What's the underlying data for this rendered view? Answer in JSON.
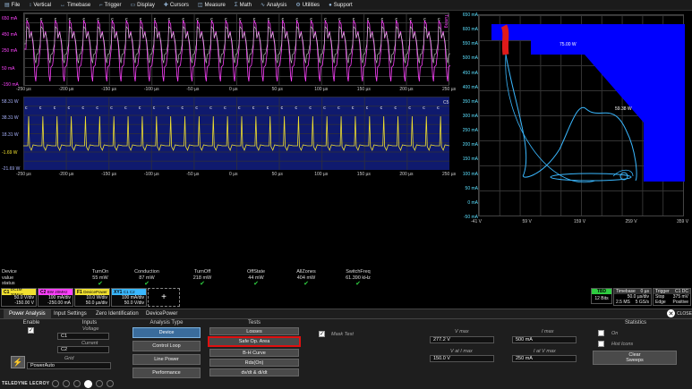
{
  "menu": [
    {
      "label": "File",
      "icon": "file-icon"
    },
    {
      "label": "Vertical",
      "icon": "vertical-icon"
    },
    {
      "label": "Timebase",
      "icon": "timebase-icon"
    },
    {
      "label": "Trigger",
      "icon": "trigger-icon"
    },
    {
      "label": "Display",
      "icon": "display-icon"
    },
    {
      "label": "Cursors",
      "icon": "cursors-icon"
    },
    {
      "label": "Measure",
      "icon": "measure-icon"
    },
    {
      "label": "Math",
      "icon": "math-icon"
    },
    {
      "label": "Analysis",
      "icon": "analysis-icon"
    },
    {
      "label": "Utilities",
      "icon": "utilities-icon"
    },
    {
      "label": "Support",
      "icon": "support-icon"
    }
  ],
  "top_grid": {
    "y_labels": [
      "650 mA",
      "450 mA",
      "250 mA",
      "50 mA",
      "-150 mA"
    ],
    "x_labels": [
      "-250 µs",
      "-200 µs",
      "-150 µs",
      "-100 µs",
      "-50 µs",
      "0 µs",
      "50 µs",
      "100 µs",
      "150 µs",
      "200 µs",
      "250 µs"
    ],
    "tag": "Tuning"
  },
  "mid_grid": {
    "y_labels": [
      "58.31 W",
      "38.31 W",
      "18.31 W",
      "-1.69 W",
      "-21.69 W"
    ],
    "x_labels": [
      "-250 µs",
      "-200 µs",
      "-150 µs",
      "-100 µs",
      "-50 µs",
      "0 µs",
      "50 µs",
      "100 µs",
      "150 µs",
      "200 µs",
      "250 µs"
    ],
    "tag": "C5"
  },
  "soa_plot": {
    "y_labels": [
      "650 mA",
      "600 mA",
      "550 mA",
      "500 mA",
      "450 mA",
      "400 mA",
      "350 mA",
      "300 mA",
      "250 mA",
      "200 mA",
      "150 mA",
      "100 mA",
      "50 mA",
      "0 mA",
      "-50 mA"
    ],
    "x_labels": [
      "-41 V",
      "59 V",
      "159 V",
      "259 V",
      "359 V"
    ],
    "annot_1": "75.00 W",
    "annot_2": "59.38 W"
  },
  "measurements": {
    "row_labels": [
      "Device",
      "value",
      "status"
    ],
    "columns": [
      {
        "name": "TurnOn",
        "value": "55 mW"
      },
      {
        "name": "Conduction",
        "value": "87 mW"
      },
      {
        "name": "TurnOff",
        "value": "218 mW"
      },
      {
        "name": "OffState",
        "value": "44 mW"
      },
      {
        "name": "AllZones",
        "value": "404 mW"
      },
      {
        "name": "SwitchFreq",
        "value": "61.390 kHz"
      }
    ]
  },
  "channels": [
    {
      "name": "C1",
      "tag": "DC1M 20MHz",
      "line1": "50.0 V/div",
      "line2": "-150.00 V",
      "color": "#f0e030"
    },
    {
      "name": "C2",
      "tag": "BW 20MHz",
      "line1": "100 mA/div",
      "line2": "-250.00 mA",
      "color": "#ff40ff"
    },
    {
      "name": "F1",
      "tag": "DevicePower",
      "line1": "10.0 W/div",
      "line2": "50.0 µs/div",
      "color": "#f0e030"
    },
    {
      "name": "XY1",
      "tag": "C1 C2",
      "line1": "100 mA/div",
      "line2": "50.0 V/div",
      "color": "#3ab8ff"
    }
  ],
  "add_label": "+",
  "status": {
    "tbd": "TBD",
    "bits": "12 Bits",
    "timebase_label": "Timebase",
    "timebase_delay": "0 µs",
    "timebase_div": "50.0 µs/div",
    "timebase_pts": "2.5 MS",
    "timebase_rate": "5 GS/s",
    "trigger_label": "Trigger",
    "trigger_chs": "C1 DC",
    "trigger_mode": "Stop",
    "trigger_level": "375 mV",
    "trigger_type": "Edge",
    "trigger_slope": "Positive"
  },
  "dialog": {
    "tabs": [
      "Power Analysis",
      "Input Settings",
      "Zero Identification",
      "DevicePower"
    ],
    "close_label": "CLOSE",
    "enable_title": "Enable",
    "inputs_title": "Inputs",
    "voltage_label": "Voltage",
    "voltage_value": "C1",
    "current_label": "Current",
    "current_value": "C2",
    "grid_label": "Grid",
    "grid_value": "PowerAuto",
    "analysis_title": "Analysis Type",
    "analysis_buttons": [
      "Device",
      "Control Loop",
      "Line Power",
      "Performance"
    ],
    "tests_title": "Tests",
    "tests_buttons": [
      "Losses",
      "Safe Op. Area",
      "B-H Curve",
      "Rds(On)",
      "dv/dt & di/dt"
    ],
    "mask_test_label": "Mask Test",
    "v_max_label": "V max",
    "v_max_value": "277.2 V",
    "i_max_label": "I max",
    "i_max_value": "500 mA",
    "v_at_imax_label": "V at I max",
    "v_at_imax_value": "150.0 V",
    "i_at_vmax_label": "I at V max",
    "i_at_vmax_value": "250 mA",
    "statistics_title": "Statistics",
    "stat_on_label": "On",
    "histicons_label": "Hist Icons",
    "clear_sweeps_line1": "Clear",
    "clear_sweeps_line2": "Sweeps"
  },
  "brand": "TELEDYNE LECROY",
  "colors": {
    "accent": "#3a6c9c",
    "highlight": "#e01010",
    "magenta": "#ff40ff",
    "yellow": "#f0e030",
    "cyan": "#3ab8ff",
    "soa_fill": "#0000ff"
  }
}
